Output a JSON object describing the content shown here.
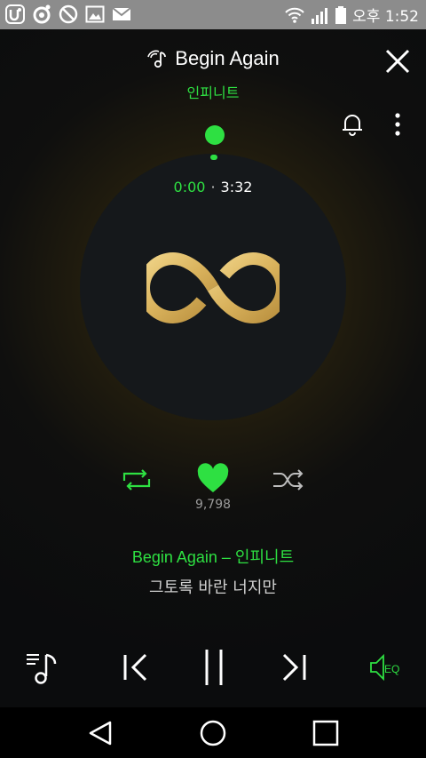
{
  "status_bar": {
    "time": "오후 1:52",
    "left_icons": [
      "u-plus-icon",
      "music-app-icon",
      "do-not-disturb-icon",
      "image-icon",
      "mail-icon"
    ],
    "right_icons": [
      "wifi-icon",
      "signal-icon",
      "battery-icon"
    ]
  },
  "player": {
    "title": "Begin Again",
    "artist": "인피니트",
    "time_current": "0:00",
    "time_separator": "·",
    "time_total": "3:32",
    "likes": "9,798",
    "song_line": "Begin Again – 인피니트",
    "lyric": "그토록 바란 너지만",
    "eq_label": "EQ",
    "progress": 0.0
  },
  "colors": {
    "accent": "#2ee042",
    "logo_gold": "#e3c06a",
    "disc": "#15181b",
    "background": "#0b0c0d"
  },
  "icons": {
    "title": "music-note-signal-icon",
    "close": "close-icon",
    "bell": "bell-icon",
    "more": "more-vertical-icon",
    "repeat": "repeat-icon",
    "like": "heart-icon",
    "shuffle": "shuffle-icon",
    "playlist": "playlist-icon",
    "prev": "skip-previous-icon",
    "pause": "pause-icon",
    "next": "skip-next-icon",
    "eq": "equalizer-icon"
  },
  "nav_bar": {
    "icons": [
      "back-icon",
      "home-icon",
      "recent-apps-icon"
    ]
  }
}
